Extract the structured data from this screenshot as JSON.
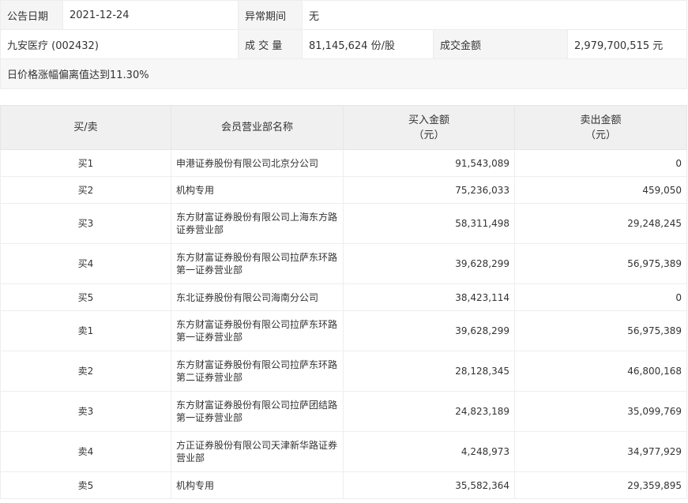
{
  "info": {
    "date_label": "公告日期",
    "date_value": "2021-12-24",
    "period_label": "异常期间",
    "period_value": "无",
    "stock": "九安医疗 (002432)",
    "volume_label": "成 交 量",
    "volume_value": "81,145,624 份/股",
    "amount_label": "成交金额",
    "amount_value": "2,979,700,515 元",
    "reason": "日价格涨幅偏离值达到11.30%"
  },
  "table": {
    "headers": {
      "side": "买/卖",
      "name": "会员营业部名称",
      "buy_line1": "买入金额",
      "buy_line2": "（元）",
      "sell_line1": "卖出金额",
      "sell_line2": "（元）"
    },
    "rows": [
      {
        "side": "买1",
        "name1": "申港证券股份有限公司北京分公司",
        "name2": "",
        "buy": "91,543,089",
        "sell": "0"
      },
      {
        "side": "买2",
        "name1": "机构专用",
        "name2": "",
        "buy": "75,236,033",
        "sell": "459,050"
      },
      {
        "side": "买3",
        "name1": "东方财富证券股份有限公司上海东方路",
        "name2": "证券营业部",
        "buy": "58,311,498",
        "sell": "29,248,245"
      },
      {
        "side": "买4",
        "name1": "东方财富证券股份有限公司拉萨东环路",
        "name2": "第一证券营业部",
        "buy": "39,628,299",
        "sell": "56,975,389"
      },
      {
        "side": "买5",
        "name1": "东北证券股份有限公司海南分公司",
        "name2": "",
        "buy": "38,423,114",
        "sell": "0"
      },
      {
        "side": "卖1",
        "name1": "东方财富证券股份有限公司拉萨东环路",
        "name2": "第一证券营业部",
        "buy": "39,628,299",
        "sell": "56,975,389"
      },
      {
        "side": "卖2",
        "name1": "东方财富证券股份有限公司拉萨东环路",
        "name2": "第二证券营业部",
        "buy": "28,128,345",
        "sell": "46,800,168"
      },
      {
        "side": "卖3",
        "name1": "东方财富证券股份有限公司拉萨团结路",
        "name2": "第一证券营业部",
        "buy": "24,823,189",
        "sell": "35,099,769"
      },
      {
        "side": "卖4",
        "name1": "方正证券股份有限公司天津新华路证券",
        "name2": "营业部",
        "buy": "4,248,973",
        "sell": "34,977,929"
      },
      {
        "side": "卖5",
        "name1": "机构专用",
        "name2": "",
        "buy": "35,582,364",
        "sell": "29,359,895"
      }
    ]
  }
}
